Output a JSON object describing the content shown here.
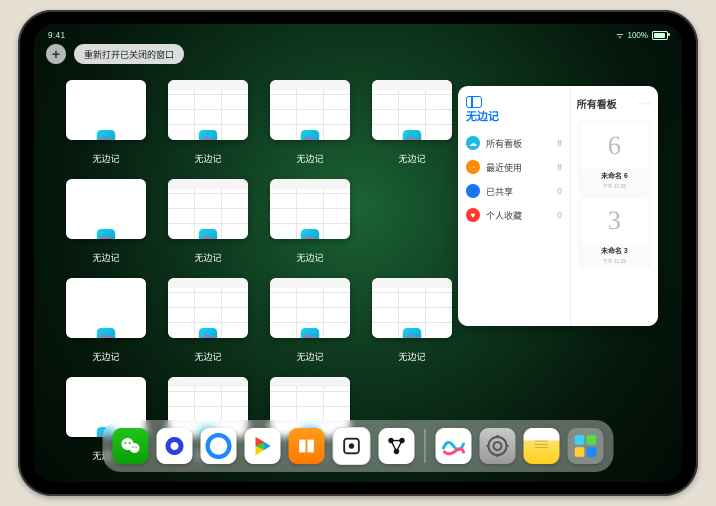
{
  "status": {
    "time": "9:41",
    "battery_pct": "100%"
  },
  "top": {
    "pill_label": "重新打开已关闭的窗口",
    "plus": "+"
  },
  "app": {
    "label": "无边记",
    "thumbs": [
      [
        "blank",
        "grid",
        "grid",
        "grid"
      ],
      [
        "blank",
        "grid",
        "grid",
        null
      ],
      [
        "blank",
        "grid",
        "grid",
        "grid"
      ],
      [
        "blank",
        "grid",
        "grid",
        null
      ]
    ]
  },
  "panel": {
    "title": "无边记",
    "right_title": "所有看板",
    "more": "···",
    "items": [
      {
        "icon": "cloud",
        "color": "#1fb9e6",
        "label": "所有看板",
        "count": "8"
      },
      {
        "icon": "clock",
        "color": "#ff8c00",
        "label": "最近使用",
        "count": "8"
      },
      {
        "icon": "share",
        "color": "#1976ff",
        "label": "已共享",
        "count": "0"
      },
      {
        "icon": "heart",
        "color": "#ff3b30",
        "label": "个人收藏",
        "count": "0"
      }
    ],
    "boards": [
      {
        "glyph": "6",
        "title": "未命名 6",
        "sub": "下午 11:26"
      },
      {
        "glyph": "3",
        "title": "未命名 3",
        "sub": "下午 11:25"
      }
    ]
  },
  "dock": {
    "icons": [
      "wechat",
      "quark",
      "baidu",
      "play",
      "books",
      "dice",
      "graph",
      "freeform",
      "settings",
      "notes",
      "folder"
    ]
  }
}
